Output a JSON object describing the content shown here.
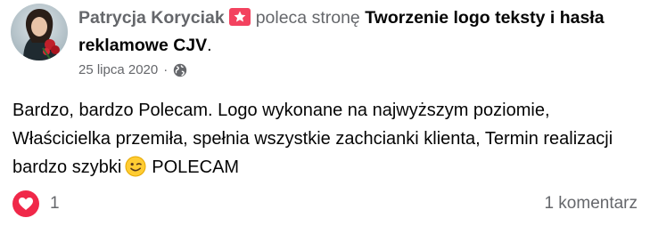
{
  "post": {
    "author": "Patrycja Koryciak",
    "action": "poleca stronę",
    "page_name": "Tworzenie logo teksty i hasła reklamowe CJV",
    "period": ".",
    "date": "25 lipca 2020",
    "separator": "·",
    "body_text": "Bardzo, bardzo Polecam. Logo wykonane na najwyższym poziomie, Właścicielka przemiła, spełnia wszystkie zachcianki klienta, Termin realizacji bardzo szybki",
    "body_suffix": "POLECAM",
    "reaction_count": "1",
    "comments": "1 komentarz"
  },
  "icons": {
    "recommend": "recommend-icon",
    "privacy": "globe-icon",
    "emoji": "winking-face-icon",
    "reaction": "heart-icon"
  },
  "colors": {
    "recommend": "#f3425f",
    "heart": "#f02849",
    "secondary_text": "#65676b",
    "primary_text": "#050505"
  }
}
